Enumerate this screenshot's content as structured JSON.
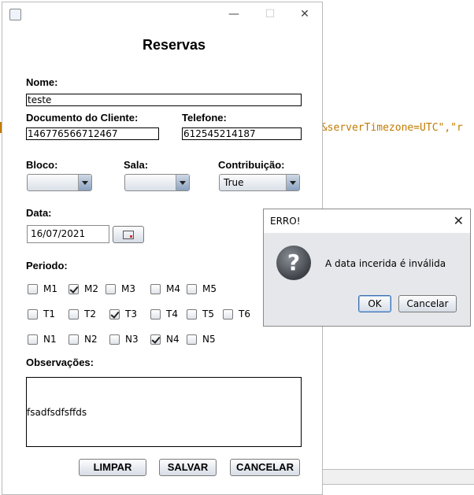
{
  "background": {
    "code_fragment": "e&serverTimezone=UTC\",\"r"
  },
  "window": {
    "title_icon": "java-icon",
    "minimize": "—",
    "maximize": "☐",
    "close": "✕"
  },
  "form": {
    "heading": "Reservas",
    "nome": {
      "label": "Nome:",
      "value": "teste"
    },
    "documento": {
      "label": "Documento do Cliente:",
      "value": "146776566712467"
    },
    "telefone": {
      "label": "Telefone:",
      "value": "612545214187"
    },
    "bloco": {
      "label": "Bloco:",
      "value": ""
    },
    "sala": {
      "label": "Sala:",
      "value": ""
    },
    "contribuicao": {
      "label": "Contribuição:",
      "value": "True"
    },
    "data": {
      "label": "Data:",
      "value": "16/07/2021"
    },
    "periodo_label": "Periodo:",
    "periodos": [
      [
        {
          "label": "M1",
          "checked": false
        },
        {
          "label": "M2",
          "checked": true
        },
        {
          "label": "M3",
          "checked": false
        },
        {
          "label": "M4",
          "checked": false
        },
        {
          "label": "M5",
          "checked": false
        }
      ],
      [
        {
          "label": "T1",
          "checked": false
        },
        {
          "label": "T2",
          "checked": false
        },
        {
          "label": "T3",
          "checked": true
        },
        {
          "label": "T4",
          "checked": false
        },
        {
          "label": "T5",
          "checked": false
        },
        {
          "label": "T6",
          "checked": false
        }
      ],
      [
        {
          "label": "N1",
          "checked": false
        },
        {
          "label": "N2",
          "checked": false
        },
        {
          "label": "N3",
          "checked": false
        },
        {
          "label": "N4",
          "checked": true
        },
        {
          "label": "N5",
          "checked": false
        }
      ]
    ],
    "observacoes": {
      "label": "Observações:",
      "value": "fsadfsdfsffds"
    },
    "buttons": {
      "limpar": "LIMPAR",
      "salvar": "SALVAR",
      "cancelar": "CANCELAR"
    }
  },
  "dialog": {
    "title": "ERRO!",
    "close": "✕",
    "icon": "question-icon",
    "message": "A data incerida é inválida",
    "ok": "OK",
    "cancel": "Cancelar"
  }
}
